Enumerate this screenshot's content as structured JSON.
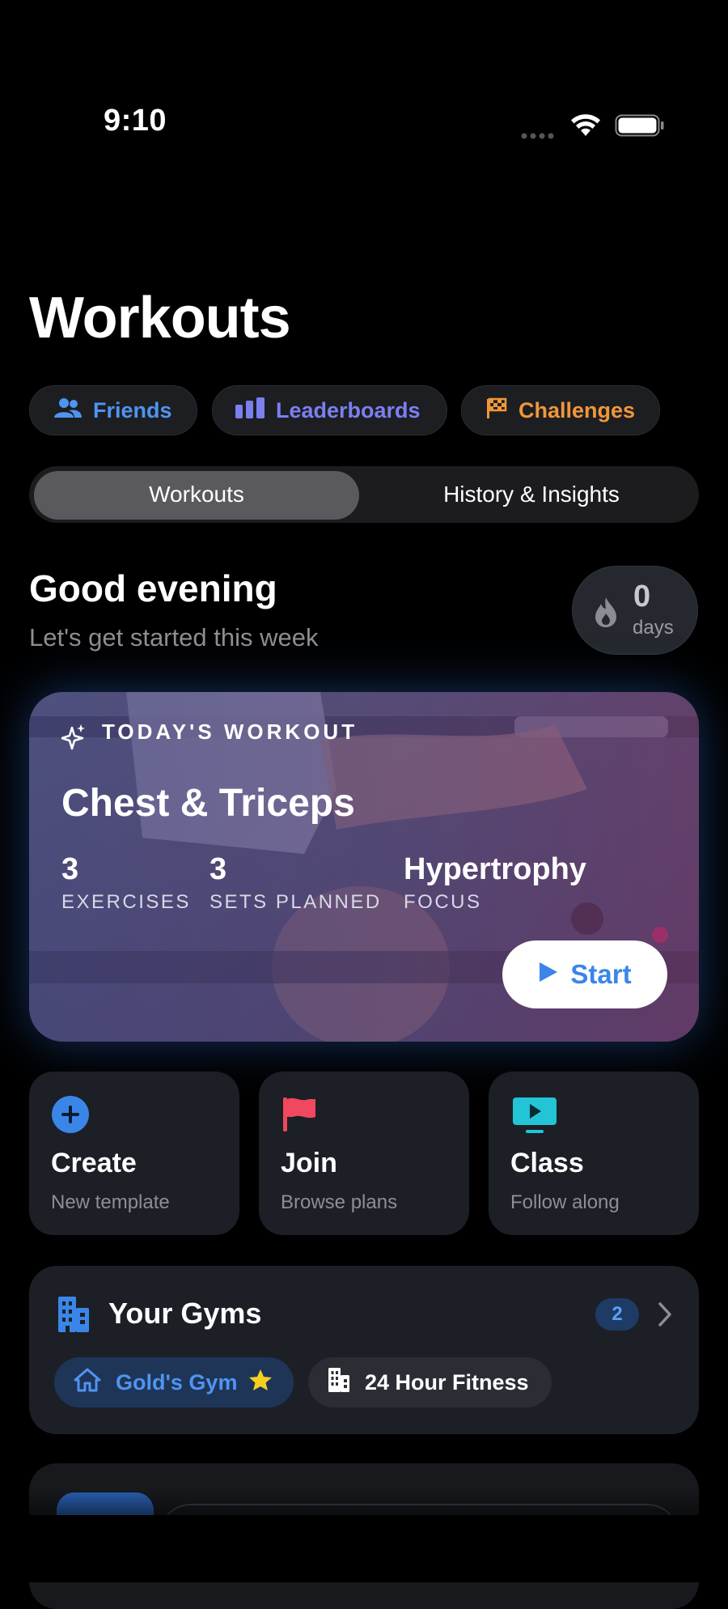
{
  "status_bar": {
    "time": "9:10"
  },
  "page": {
    "title": "Workouts"
  },
  "quick_pills": [
    {
      "label": "Friends",
      "icon": "people-icon",
      "color": "#4f94f0"
    },
    {
      "label": "Leaderboards",
      "icon": "bar-chart-icon",
      "color": "#7b7ff0"
    },
    {
      "label": "Challenges",
      "icon": "checkered-flag-icon",
      "color": "#f0973a"
    }
  ],
  "segmented": {
    "options": [
      "Workouts",
      "History & Insights"
    ],
    "selected": "Workouts"
  },
  "greeting": {
    "title": "Good evening",
    "subtitle": "Let's get started this week"
  },
  "streak": {
    "value": "0",
    "unit": "days",
    "icon": "flame-icon"
  },
  "today": {
    "eyebrow": "TODAY'S WORKOUT",
    "title": "Chest & Triceps",
    "stats": [
      {
        "value": "3",
        "label": "EXERCISES"
      },
      {
        "value": "3",
        "label": "SETS PLANNED"
      },
      {
        "value": "Hypertrophy",
        "label": "FOCUS"
      }
    ],
    "start_label": "Start"
  },
  "actions": [
    {
      "title": "Create",
      "subtitle": "New template",
      "icon": "plus-circle-icon",
      "color": "#3a86e8"
    },
    {
      "title": "Join",
      "subtitle": "Browse plans",
      "icon": "flag-icon",
      "color": "#f0485e"
    },
    {
      "title": "Class",
      "subtitle": "Follow along",
      "icon": "tv-play-icon",
      "color": "#22c4d6"
    }
  ],
  "gyms": {
    "title": "Your Gyms",
    "count": "2",
    "items": [
      {
        "name": "Gold's Gym",
        "icon": "house-icon",
        "favorite": true
      },
      {
        "name": "24 Hour Fitness",
        "icon": "building-icon",
        "favorite": false
      }
    ]
  }
}
